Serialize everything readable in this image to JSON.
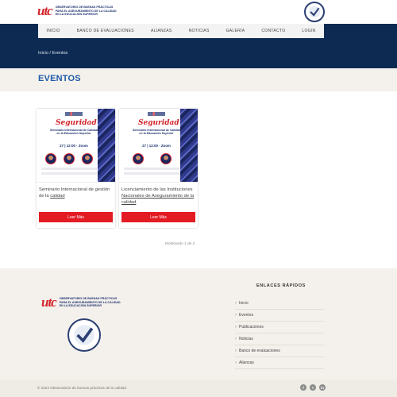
{
  "header": {
    "logo_mark": "utc",
    "logo_text": "OBSERVATORIO DE BUENAS PRÁCTICAS PARA EL ASEGURAMIENTO DE LA CALIDAD EN LA EDUCACIÓN SUPERIOR",
    "seal_icon": "checkmark-seal-icon"
  },
  "nav": {
    "items": [
      "INICIO",
      "BANCO DE EVALUACIONES",
      "ALIANZAS",
      "NOTICIAS",
      "GALERÍA",
      "CONTACTO",
      "LOGIN"
    ]
  },
  "breadcrumb": {
    "home": "Inicio",
    "sep": "/",
    "current": "Eventos"
  },
  "page": {
    "title": "EVENTOS"
  },
  "cards": [
    {
      "poster_script": "Seguridad",
      "poster_title": "Seminario Internacional de Calidad en la Educación Superior",
      "poster_date": "27 | 12:00 · Zoom",
      "text": "Seminario Internacional de gestión de la",
      "link": "calidad",
      "button": "Leer Más"
    },
    {
      "poster_script": "Seguridad",
      "poster_title": "Seminario Internacional de Calidad en la Educación Superior",
      "poster_date": "27 | 13:00 · Zoom",
      "text": "Licenciamiento de las Instituciones",
      "link": "Nacionales de Aseguramiento de la calidad",
      "button": "Leer Más"
    }
  ],
  "pager": "Mostrando 1 de 2",
  "footer": {
    "links_heading": "ENLACES RÁPIDOS",
    "links": [
      "Inicio",
      "Eventos",
      "Publicaciones",
      "Noticias",
      "Banco de evaluaciones",
      "Alianzas"
    ],
    "copyright": "© 2024 Observatorio de buenas prácticas de la calidad",
    "social": [
      "f",
      "t",
      "in"
    ]
  }
}
